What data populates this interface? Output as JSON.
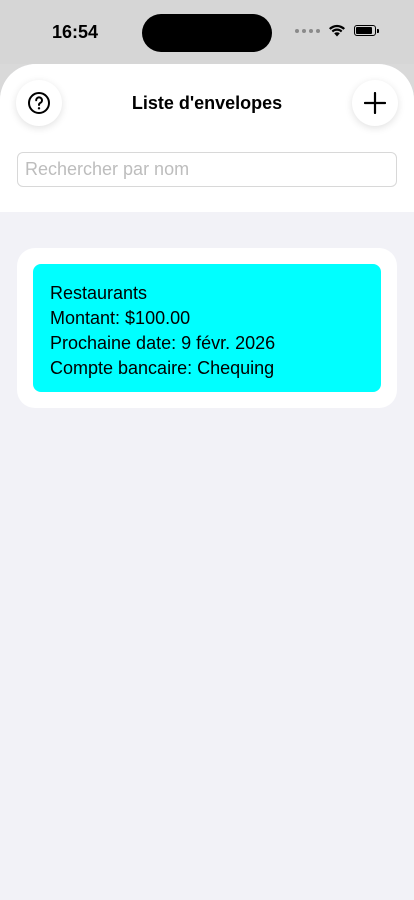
{
  "status_bar": {
    "time": "16:54"
  },
  "header": {
    "title": "Liste d'envelopes",
    "help_icon": "help-circle-icon",
    "add_icon": "plus-icon"
  },
  "search": {
    "placeholder": "Rechercher par nom",
    "value": ""
  },
  "envelopes": [
    {
      "name": "Restaurants",
      "amount": "Montant: $100.00",
      "next_date": "Prochaine date: 9 févr. 2026",
      "account": "Compte bancaire: Chequing",
      "color": "#00ffff"
    }
  ],
  "colors": {
    "sheet_background": "#f2f2f7",
    "envelope_color": "#00ffff"
  }
}
